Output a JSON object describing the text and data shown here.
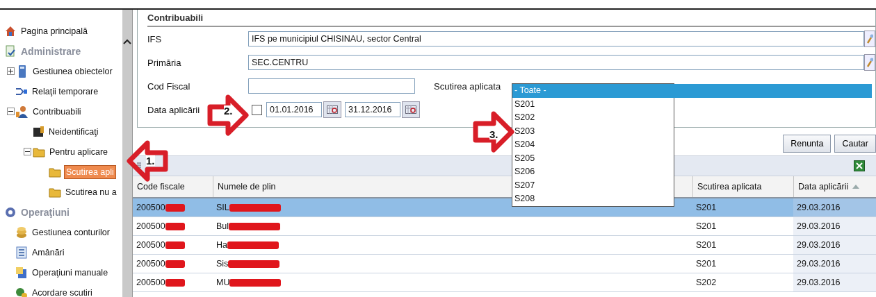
{
  "sidebar": {
    "items": [
      {
        "kind": "link",
        "label": "Pagina principală",
        "selected": false
      },
      {
        "kind": "section",
        "label": "Administrare",
        "children": [
          {
            "kind": "node",
            "label": "Gestiunea obiectelor",
            "expanded": false,
            "selected": false
          },
          {
            "kind": "node",
            "label": "Relaţii temporare",
            "selected": false
          },
          {
            "kind": "node",
            "label": "Contribuabili",
            "expanded": true,
            "selected": false,
            "children": [
              {
                "kind": "node",
                "label": "Neidentificaţi",
                "selected": false
              },
              {
                "kind": "node",
                "label": "Pentru aplicare",
                "expanded": true,
                "selected": false,
                "children": [
                  {
                    "kind": "node",
                    "label": "Scutirea apli",
                    "selected": true
                  },
                  {
                    "kind": "node",
                    "label": "Scutirea nu a",
                    "selected": false
                  }
                ]
              }
            ]
          }
        ]
      },
      {
        "kind": "section",
        "label": "Operaţiuni",
        "children": [
          {
            "kind": "node",
            "label": "Gestiunea conturilor",
            "selected": false
          },
          {
            "kind": "node",
            "label": "Amânări",
            "selected": false
          },
          {
            "kind": "node",
            "label": "Operaţiuni manuale",
            "selected": false
          },
          {
            "kind": "node",
            "label": "Acordare scutiri",
            "selected": false
          }
        ]
      }
    ]
  },
  "filter": {
    "title": "Contribuabili",
    "ifs": {
      "label": "IFS",
      "value": "IFS pe municipiul CHISINAU, sector Central"
    },
    "primaria": {
      "label": "Primăria",
      "value": "SEC.CENTRU"
    },
    "cod_fiscal": {
      "label": "Cod Fiscal"
    },
    "data": {
      "label": "Data aplicării",
      "checked": false,
      "from": "01.01.2016",
      "to": "31.12.2016"
    },
    "scutirea": {
      "label": "Scutirea aplicata",
      "options": [
        {
          "label": "- Toate -",
          "selected": true
        },
        {
          "label": "S201",
          "selected": false
        },
        {
          "label": "S202",
          "selected": false
        },
        {
          "label": "S203",
          "selected": false
        },
        {
          "label": "S204",
          "selected": false
        },
        {
          "label": "S205",
          "selected": false
        },
        {
          "label": "S206",
          "selected": false
        },
        {
          "label": "S207",
          "selected": false
        },
        {
          "label": "S208",
          "selected": false
        }
      ]
    }
  },
  "buttons": [
    "Renunta",
    "Cautar"
  ],
  "annotations": [
    "1.",
    "2.",
    "3."
  ],
  "table": {
    "columns": [
      "Code fiscale",
      "Numele de plin",
      "Scutirea aplicata",
      "Data aplicării"
    ],
    "rows": [
      {
        "cells": [
          "200500",
          "SIL",
          "S201",
          "29.03.2016"
        ],
        "selected": true
      },
      {
        "cells": [
          "200500",
          "Bul",
          "S201",
          "29.03.2016"
        ],
        "selected": false
      },
      {
        "cells": [
          "200500",
          "Ha",
          "S201",
          "29.03.2016"
        ],
        "selected": false
      },
      {
        "cells": [
          "200500",
          "Sis",
          "S201",
          "29.03.2016"
        ],
        "selected": false
      },
      {
        "cells": [
          "200500",
          "MU",
          "S202",
          "29.03.2016"
        ],
        "selected": false
      }
    ]
  }
}
